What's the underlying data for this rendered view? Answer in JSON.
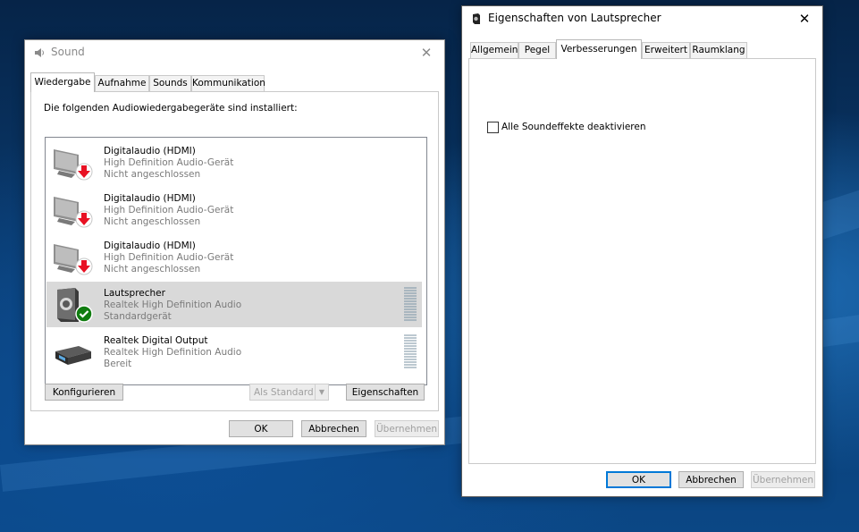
{
  "sound": {
    "title": "Sound",
    "tabs": [
      {
        "label": "Wiedergabe",
        "active": true
      },
      {
        "label": "Aufnahme"
      },
      {
        "label": "Sounds"
      },
      {
        "label": "Kommunikation"
      }
    ],
    "heading": "Die folgenden Audiowiedergabegeräte sind installiert:",
    "devices": [
      {
        "name": "Digitalaudio (HDMI)",
        "line1": "High Definition Audio-Gerät",
        "line2": "Nicht angeschlossen",
        "icon": "monitor-disconnected-icon"
      },
      {
        "name": "Digitalaudio (HDMI)",
        "line1": "High Definition Audio-Gerät",
        "line2": "Nicht angeschlossen",
        "icon": "monitor-disconnected-icon"
      },
      {
        "name": "Digitalaudio (HDMI)",
        "line1": "High Definition Audio-Gerät",
        "line2": "Nicht angeschlossen",
        "icon": "monitor-disconnected-icon"
      },
      {
        "name": "Lautsprecher",
        "line1": "Realtek High Definition Audio",
        "line2": "Standardgerät",
        "icon": "speaker-default-icon",
        "selected": true
      },
      {
        "name": "Realtek Digital Output",
        "line1": "Realtek High Definition Audio",
        "line2": "Bereit",
        "icon": "digital-output-icon"
      }
    ],
    "buttons": {
      "configure": "Konfigurieren",
      "set_default": "Als Standard",
      "properties": "Eigenschaften",
      "ok": "OK",
      "cancel": "Abbrechen",
      "apply": "Übernehmen"
    }
  },
  "props": {
    "title": "Eigenschaften von Lautsprecher",
    "tabs": [
      {
        "label": "Allgemein"
      },
      {
        "label": "Pegel"
      },
      {
        "label": "Verbesserungen",
        "active": true
      },
      {
        "label": "Erweitert"
      },
      {
        "label": "Raumklang"
      }
    ],
    "checkbox_label": "Alle Soundeffekte deaktivieren",
    "checkbox_checked": false,
    "buttons": {
      "ok": "OK",
      "cancel": "Abbrechen",
      "apply": "Übernehmen"
    }
  },
  "colors": {
    "accent": "#0078d7",
    "selection": "#d9d9d9",
    "arrow_red": "#e81123",
    "check_green": "#107c10"
  }
}
